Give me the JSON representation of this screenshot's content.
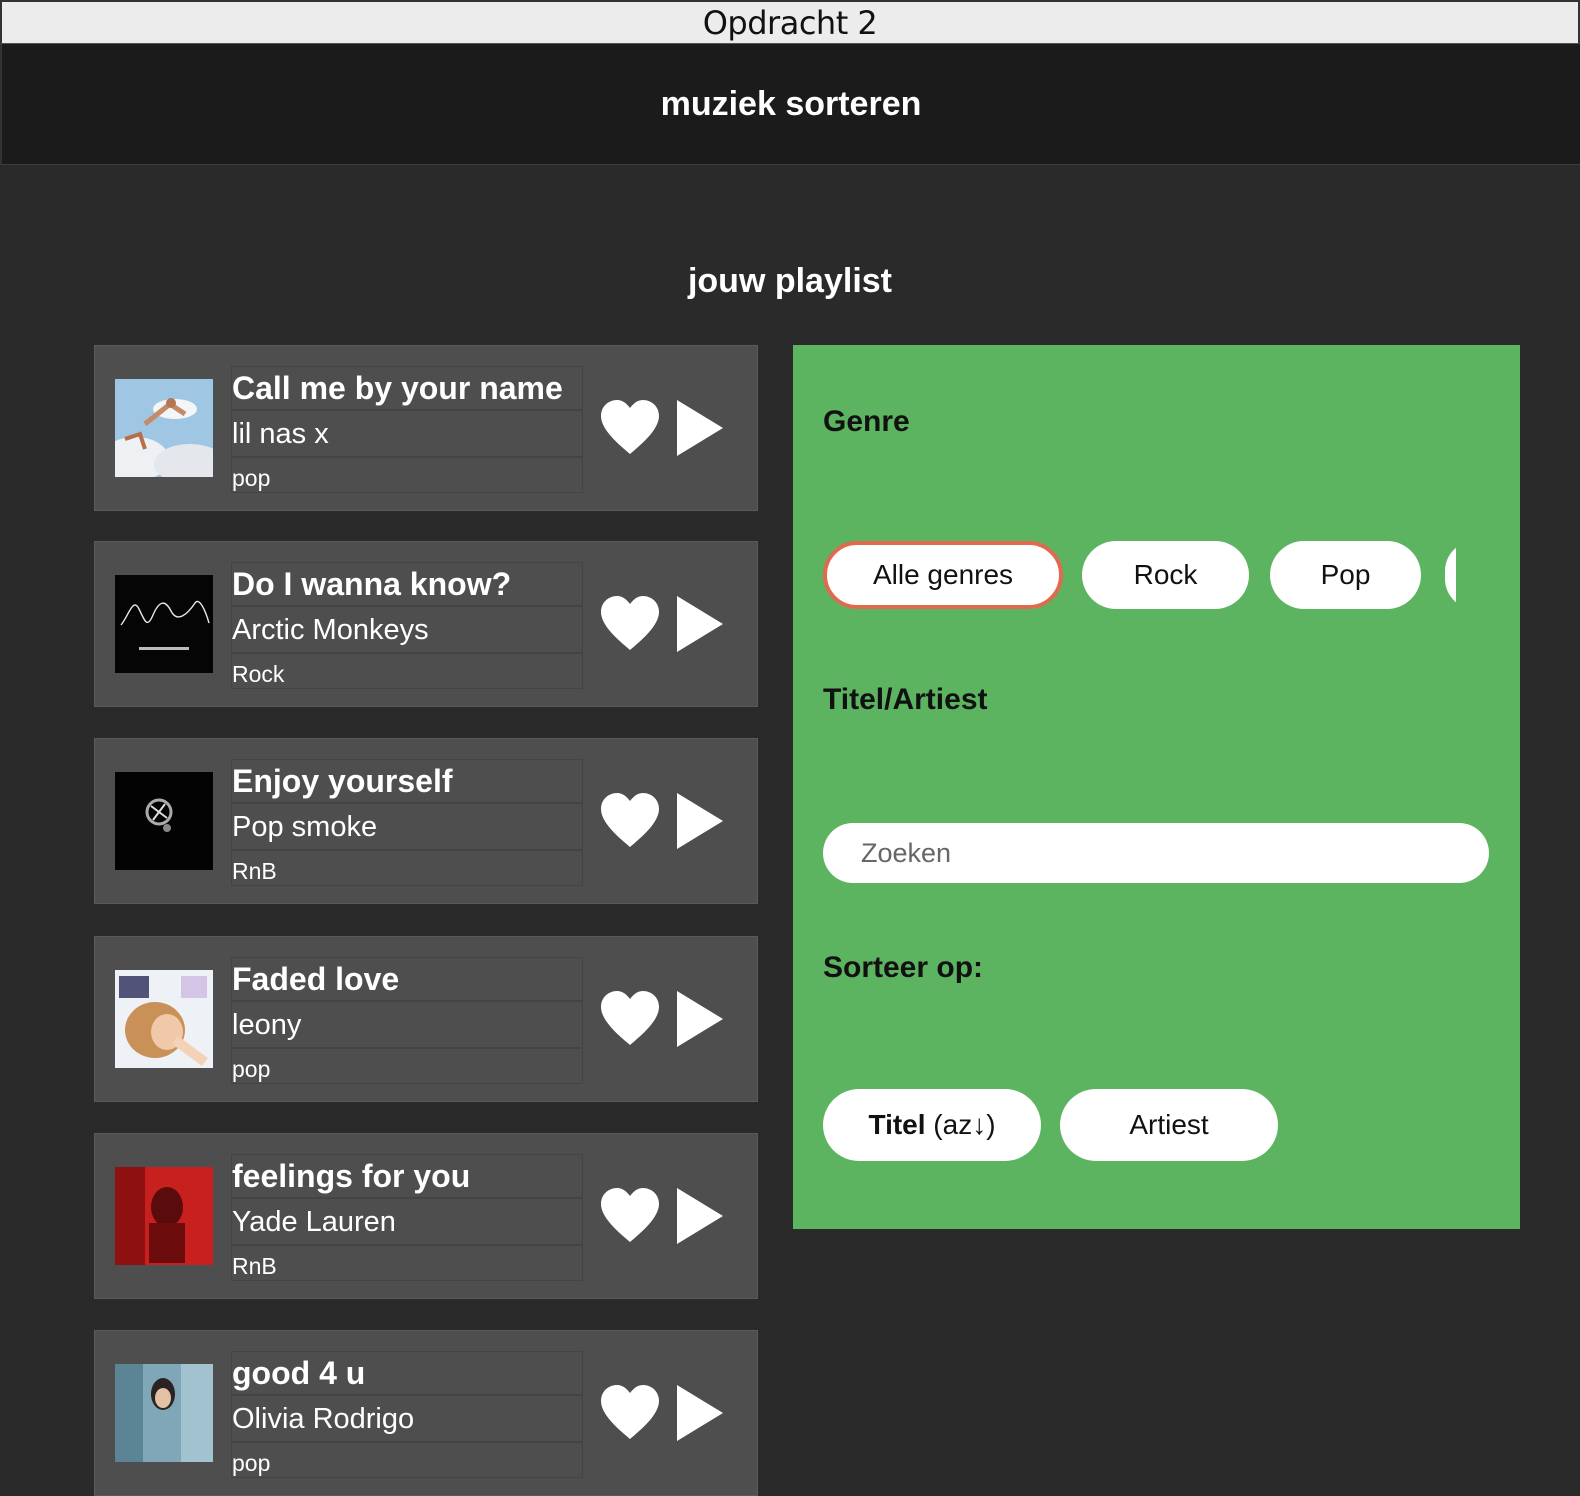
{
  "window": {
    "title": "Opdracht 2"
  },
  "header": {
    "title": "muziek sorteren"
  },
  "playlist": {
    "heading": "jouw playlist",
    "songs": [
      {
        "title": "Call me by your name",
        "artist": "lil nas x",
        "genre": "pop"
      },
      {
        "title": "Do I wanna know?",
        "artist": "Arctic Monkeys",
        "genre": "Rock"
      },
      {
        "title": "Enjoy yourself",
        "artist": "Pop smoke",
        "genre": "RnB"
      },
      {
        "title": "Faded love",
        "artist": "leony",
        "genre": "pop"
      },
      {
        "title": "feelings for you",
        "artist": "Yade Lauren",
        "genre": "RnB"
      },
      {
        "title": "good 4 u",
        "artist": "Olivia Rodrigo",
        "genre": "pop"
      }
    ],
    "icons": {
      "like": "heart-icon",
      "play": "play-icon"
    }
  },
  "filters": {
    "genre_label": "Genre",
    "genres": [
      "Alle genres",
      "Rock",
      "Pop"
    ],
    "selected_genre": "Alle genres",
    "search_label": "Titel/Artiest",
    "search_placeholder": "Zoeken",
    "search_value": "",
    "sort_label": "Sorteer op:",
    "sort_options": {
      "title_bold": "Titel",
      "title_suffix": " (az↓)",
      "artist": "Artiest"
    }
  },
  "colors": {
    "panel": "#5cb461",
    "card": "#4e4e4e",
    "background": "#2a2a2a",
    "header": "#1b1b1b",
    "active_outline": "#e06a4e"
  }
}
